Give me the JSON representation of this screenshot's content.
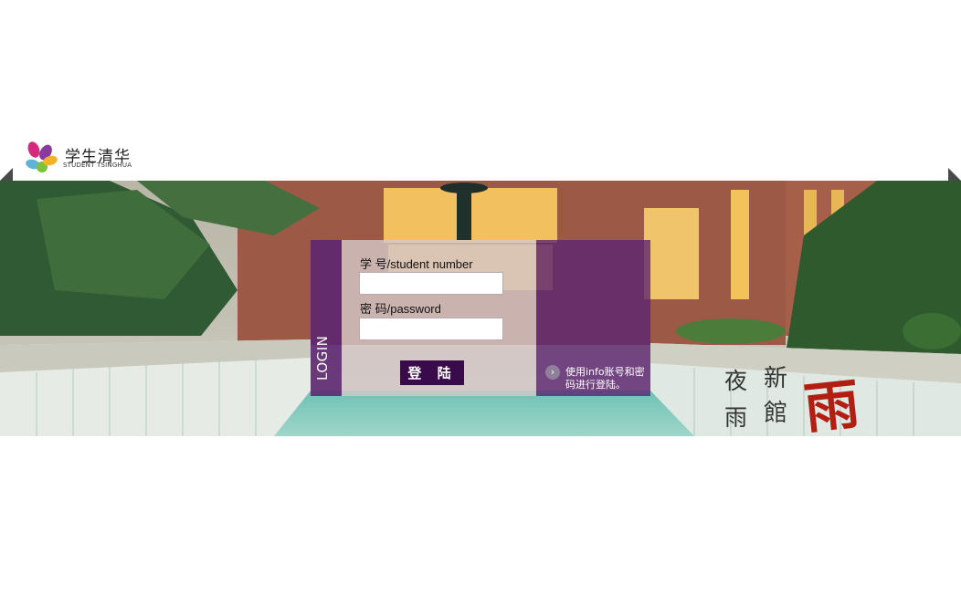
{
  "header": {
    "logo_cn": "学生清华",
    "logo_en": "STUDENT TSINGHUA",
    "logo_colors": [
      "#d6287c",
      "#8a3a9b",
      "#f2b22a",
      "#5fb3d9",
      "#7cc142"
    ]
  },
  "login": {
    "side_title": "LOGIN",
    "username_label": "学  号/student number",
    "username_value": "",
    "password_label": "密  码/password",
    "password_value": "",
    "submit_label": "登 陆",
    "info_arrow": "›",
    "info_text": "使用info账号和密码进行登陆。",
    "accent_color": "#3a0b4a",
    "panel_color": "#5c2470"
  },
  "banner": {
    "calligraphy_col1": "夜雨",
    "calligraphy_col2": "新館",
    "calligraphy_big": "雨"
  }
}
